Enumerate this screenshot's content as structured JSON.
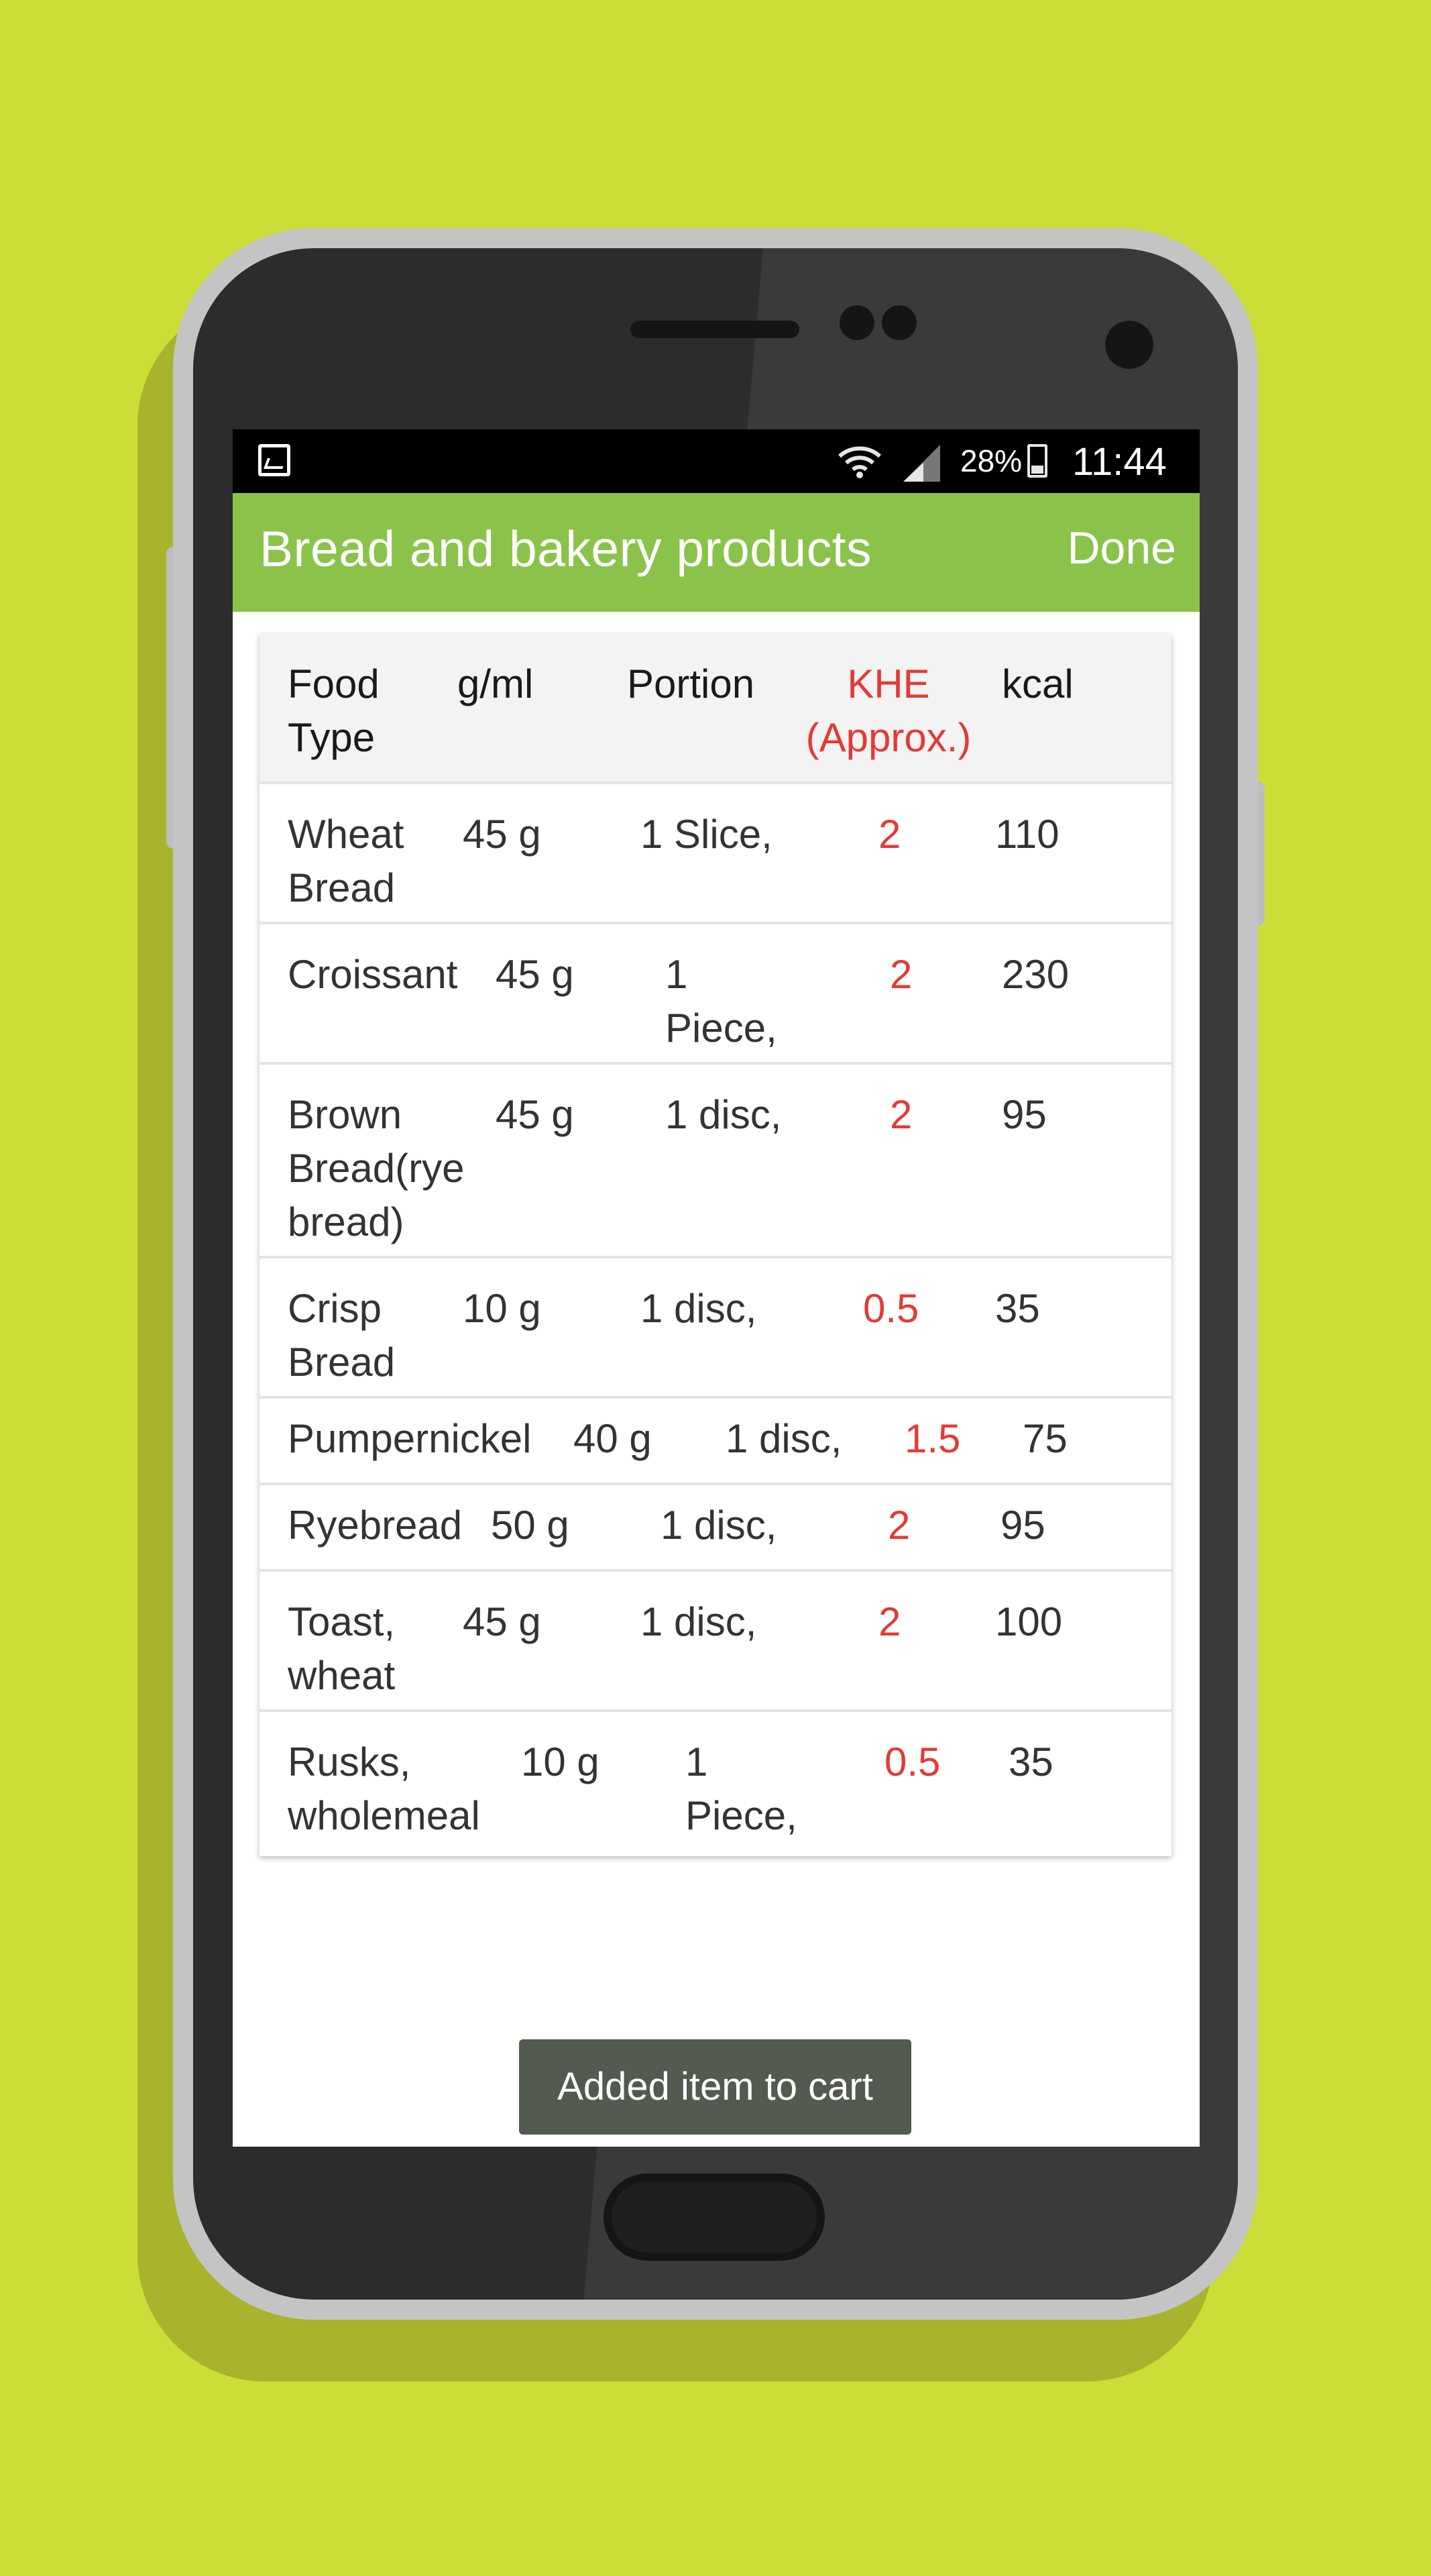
{
  "status_bar": {
    "battery": "28%",
    "time": "11:44"
  },
  "app_bar": {
    "title": "Bread and bakery products",
    "done_label": "Done"
  },
  "table": {
    "headers": {
      "food_type_1": "Food",
      "food_type_2": "Type",
      "weight": "g/ml",
      "portion": "Portion",
      "khe_1": "KHE",
      "khe_2": "(Approx.)",
      "kcal": "kcal"
    },
    "rows": [
      {
        "name_1": "Wheat",
        "name_2": "Bread",
        "name_3": "",
        "weight": "45 g",
        "portion_1": "1 Slice,",
        "portion_2": "",
        "khe": "2",
        "kcal": "110"
      },
      {
        "name_1": "Croissant",
        "name_2": "",
        "name_3": "",
        "weight": "45 g",
        "portion_1": "1",
        "portion_2": "Piece,",
        "khe": "2",
        "kcal": "230"
      },
      {
        "name_1": "Brown",
        "name_2": "Bread(rye",
        "name_3": "bread)",
        "weight": "45 g",
        "portion_1": "1 disc,",
        "portion_2": "",
        "khe": "2",
        "kcal": "95"
      },
      {
        "name_1": "Crisp",
        "name_2": "Bread",
        "name_3": "",
        "weight": "10 g",
        "portion_1": "1 disc,",
        "portion_2": "",
        "khe": "0.5",
        "kcal": "35"
      },
      {
        "name_1": "Pumpernickel",
        "name_2": "",
        "name_3": "",
        "weight": "40 g",
        "portion_1": "1 disc,",
        "portion_2": "",
        "khe": "1.5",
        "kcal": "75"
      },
      {
        "name_1": "Ryebread",
        "name_2": "",
        "name_3": "",
        "weight": "50 g",
        "portion_1": "1 disc,",
        "portion_2": "",
        "khe": "2",
        "kcal": "95"
      },
      {
        "name_1": "Toast,",
        "name_2": "wheat",
        "name_3": "",
        "weight": "45 g",
        "portion_1": "1 disc,",
        "portion_2": "",
        "khe": "2",
        "kcal": "100"
      },
      {
        "name_1": "Rusks,",
        "name_2": "wholemeal",
        "name_3": "",
        "weight": "10 g",
        "portion_1": "1",
        "portion_2": "Piece,",
        "khe": "0.5",
        "kcal": "35"
      }
    ]
  },
  "toast": {
    "message": "Added item to cart"
  },
  "colors": {
    "background": "#cddd38",
    "app_bar": "#8bc34a",
    "khe_red": "#e53935"
  }
}
